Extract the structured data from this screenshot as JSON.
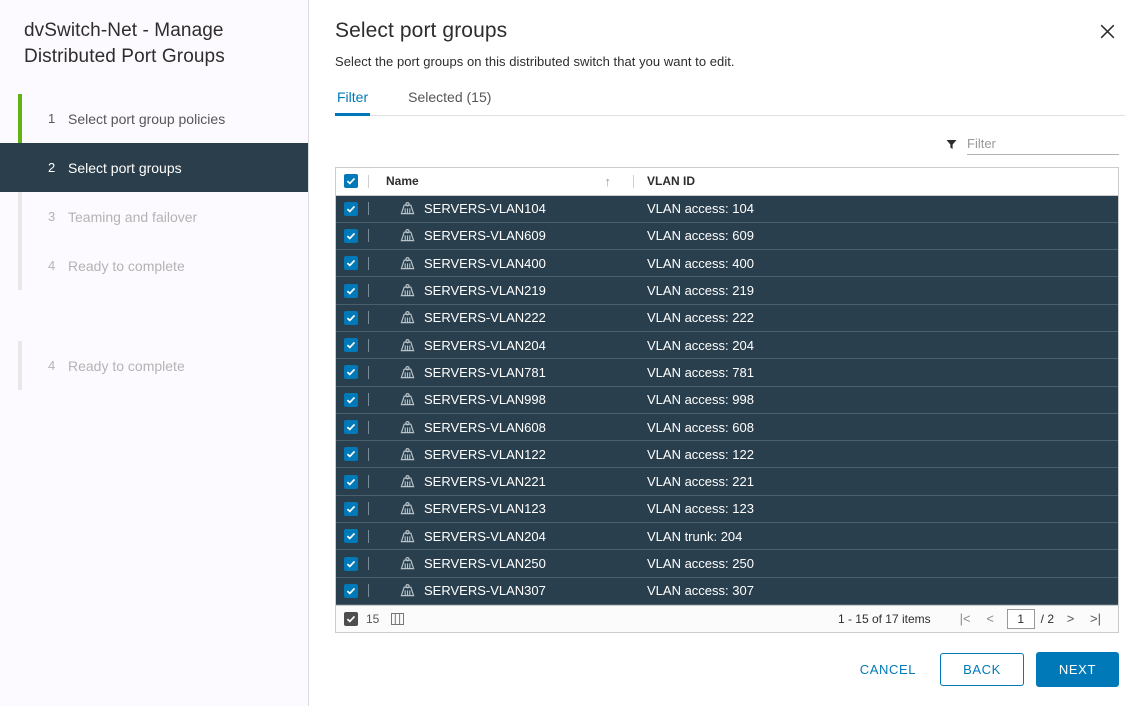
{
  "sidebar": {
    "title": "dvSwitch-Net - Manage Distributed Port Groups",
    "steps": [
      {
        "num": "1",
        "label": "Select port group policies",
        "state": "done"
      },
      {
        "num": "2",
        "label": "Select port groups",
        "state": "active"
      },
      {
        "num": "3",
        "label": "Teaming and failover",
        "state": "upcoming"
      },
      {
        "num": "4",
        "label": "Ready to complete",
        "state": "upcoming"
      }
    ],
    "extra_steps": [
      {
        "num": "4",
        "label": "Ready to complete",
        "state": "upcoming"
      }
    ]
  },
  "header": {
    "title": "Select port groups",
    "subtitle": "Select the port groups on this distributed switch that you want to edit.",
    "close_icon": "close-icon"
  },
  "tabs": [
    {
      "label": "Filter",
      "active": true
    },
    {
      "label": "Selected (15)",
      "active": false
    }
  ],
  "filter": {
    "icon": "funnel-icon",
    "placeholder": "Filter",
    "value": ""
  },
  "table": {
    "columns": [
      {
        "key": "checkbox",
        "label": ""
      },
      {
        "key": "name",
        "label": "Name",
        "sort": "ascending"
      },
      {
        "key": "vlan",
        "label": "VLAN ID"
      }
    ],
    "header_checkbox_checked": true,
    "row_icon": "port-group-icon",
    "rows": [
      {
        "checked": true,
        "name": "SERVERS-VLAN104",
        "vlan": "VLAN access: 104"
      },
      {
        "checked": true,
        "name": "SERVERS-VLAN609",
        "vlan": "VLAN access: 609"
      },
      {
        "checked": true,
        "name": "SERVERS-VLAN400",
        "vlan": "VLAN access: 400"
      },
      {
        "checked": true,
        "name": "SERVERS-VLAN219",
        "vlan": "VLAN access: 219"
      },
      {
        "checked": true,
        "name": "SERVERS-VLAN222",
        "vlan": "VLAN access: 222"
      },
      {
        "checked": true,
        "name": "SERVERS-VLAN204",
        "vlan": "VLAN access: 204"
      },
      {
        "checked": true,
        "name": "SERVERS-VLAN781",
        "vlan": "VLAN access: 781"
      },
      {
        "checked": true,
        "name": "SERVERS-VLAN998",
        "vlan": "VLAN access: 998"
      },
      {
        "checked": true,
        "name": "SERVERS-VLAN608",
        "vlan": "VLAN access: 608"
      },
      {
        "checked": true,
        "name": "SERVERS-VLAN122",
        "vlan": "VLAN access: 122"
      },
      {
        "checked": true,
        "name": "SERVERS-VLAN221",
        "vlan": "VLAN access: 221"
      },
      {
        "checked": true,
        "name": "SERVERS-VLAN123",
        "vlan": "VLAN access: 123"
      },
      {
        "checked": true,
        "name": "SERVERS-VLAN204",
        "vlan": "VLAN trunk: 204"
      },
      {
        "checked": true,
        "name": "SERVERS-VLAN250",
        "vlan": "VLAN access: 250"
      },
      {
        "checked": true,
        "name": "SERVERS-VLAN307",
        "vlan": "VLAN access: 307"
      }
    ]
  },
  "table_footer": {
    "selected_checkbox_checked": true,
    "selected_count": "15",
    "column_toggle_icon": "columns-icon",
    "range_text": "1 - 15 of 17 items",
    "first_page_label": "|<",
    "prev_page_label": "<",
    "page_value": "1",
    "total_pages": "/ 2",
    "next_page_label": ">",
    "last_page_label": ">|"
  },
  "footer": {
    "cancel_label": "CANCEL",
    "back_label": "BACK",
    "next_label": "NEXT"
  },
  "colors": {
    "accent_blue": "#0079b8",
    "step_done_green": "#60b515",
    "active_step_bg": "#2b3e4c",
    "row_bg": "#2a3f4d"
  }
}
